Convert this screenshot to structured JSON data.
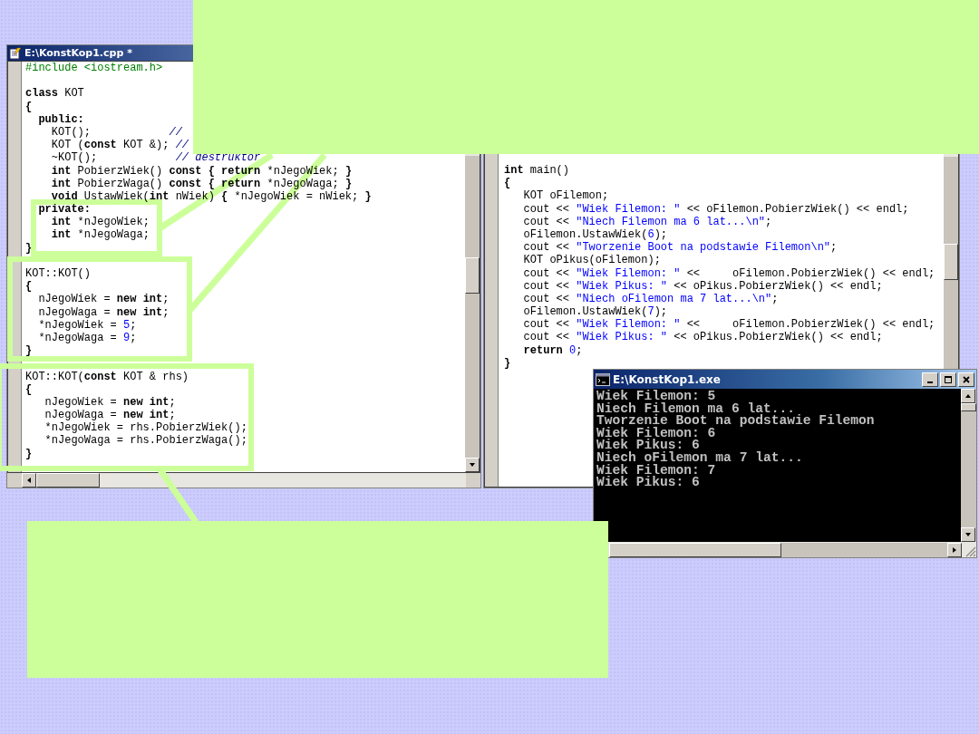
{
  "editor_left": {
    "title": "E:\\KonstKop1.cpp *",
    "lines": [
      {
        "kind": "code",
        "tokens": [
          {
            "kind": "green",
            "text": "#include <iostream.h>"
          }
        ]
      },
      {
        "kind": "blank"
      },
      {
        "kind": "code",
        "tokens": [
          {
            "kind": "bold",
            "text": "class"
          },
          {
            "kind": "plain",
            "text": " KOT"
          }
        ]
      },
      {
        "kind": "code",
        "tokens": [
          {
            "kind": "bold",
            "text": "{"
          }
        ]
      },
      {
        "kind": "code",
        "tokens": [
          {
            "kind": "bold",
            "text": "  public:"
          }
        ]
      },
      {
        "kind": "code",
        "tokens": [
          {
            "kind": "plain",
            "text": "    KOT();            "
          },
          {
            "kind": "comment",
            "text": "//"
          }
        ]
      },
      {
        "kind": "code",
        "tokens": [
          {
            "kind": "plain",
            "text": "    KOT ("
          },
          {
            "kind": "bold",
            "text": "const"
          },
          {
            "kind": "plain",
            "text": " KOT &); "
          },
          {
            "kind": "comment",
            "text": "//"
          }
        ]
      },
      {
        "kind": "code",
        "tokens": [
          {
            "kind": "plain",
            "text": "    ~KOT();            "
          },
          {
            "kind": "comment",
            "text": "// destruktor"
          }
        ]
      },
      {
        "kind": "code",
        "tokens": [
          {
            "kind": "bold",
            "text": "    int"
          },
          {
            "kind": "plain",
            "text": " PobierzWiek() "
          },
          {
            "kind": "bold",
            "text": "const { return"
          },
          {
            "kind": "plain",
            "text": " *nJegoWiek; "
          },
          {
            "kind": "bold",
            "text": "}"
          }
        ]
      },
      {
        "kind": "code",
        "tokens": [
          {
            "kind": "bold",
            "text": "    int"
          },
          {
            "kind": "plain",
            "text": " PobierzWaga() "
          },
          {
            "kind": "bold",
            "text": "const { return"
          },
          {
            "kind": "plain",
            "text": " *nJegoWaga; "
          },
          {
            "kind": "bold",
            "text": "}"
          }
        ]
      },
      {
        "kind": "code",
        "tokens": [
          {
            "kind": "bold",
            "text": "    void"
          },
          {
            "kind": "plain",
            "text": " UstawWiek("
          },
          {
            "kind": "bold",
            "text": "int"
          },
          {
            "kind": "plain",
            "text": " nWiek) "
          },
          {
            "kind": "bold",
            "text": "{"
          },
          {
            "kind": "plain",
            "text": " *nJegoWiek = nWiek; "
          },
          {
            "kind": "bold",
            "text": "}"
          }
        ]
      },
      {
        "kind": "code",
        "tokens": [
          {
            "kind": "bold",
            "text": "  private:"
          }
        ]
      },
      {
        "kind": "code",
        "tokens": [
          {
            "kind": "bold",
            "text": "    int"
          },
          {
            "kind": "plain",
            "text": " *nJegoWiek;"
          }
        ]
      },
      {
        "kind": "code",
        "tokens": [
          {
            "kind": "bold",
            "text": "    int"
          },
          {
            "kind": "plain",
            "text": " *nJegoWaga;"
          }
        ]
      },
      {
        "kind": "code",
        "tokens": [
          {
            "kind": "bold",
            "text": "}"
          }
        ]
      },
      {
        "kind": "blank"
      },
      {
        "kind": "code",
        "tokens": [
          {
            "kind": "plain",
            "text": "KOT::KOT()"
          }
        ]
      },
      {
        "kind": "code",
        "tokens": [
          {
            "kind": "bold",
            "text": "{"
          }
        ]
      },
      {
        "kind": "code",
        "tokens": [
          {
            "kind": "plain",
            "text": "  nJegoWiek = "
          },
          {
            "kind": "bold",
            "text": "new int"
          },
          {
            "kind": "plain",
            "text": ";"
          }
        ]
      },
      {
        "kind": "code",
        "tokens": [
          {
            "kind": "plain",
            "text": "  nJegoWaga = "
          },
          {
            "kind": "bold",
            "text": "new int"
          },
          {
            "kind": "plain",
            "text": ";"
          }
        ]
      },
      {
        "kind": "code",
        "tokens": [
          {
            "kind": "plain",
            "text": "  *nJegoWiek = "
          },
          {
            "kind": "blue",
            "text": "5"
          },
          {
            "kind": "plain",
            "text": ";"
          }
        ]
      },
      {
        "kind": "code",
        "tokens": [
          {
            "kind": "plain",
            "text": "  *nJegoWaga = "
          },
          {
            "kind": "blue",
            "text": "9"
          },
          {
            "kind": "plain",
            "text": ";"
          }
        ]
      },
      {
        "kind": "code",
        "tokens": [
          {
            "kind": "bold",
            "text": "}"
          }
        ]
      },
      {
        "kind": "blank"
      },
      {
        "kind": "code",
        "tokens": [
          {
            "kind": "plain",
            "text": "KOT::KOT("
          },
          {
            "kind": "bold",
            "text": "const"
          },
          {
            "kind": "plain",
            "text": " KOT & rhs)"
          }
        ]
      },
      {
        "kind": "code",
        "tokens": [
          {
            "kind": "bold",
            "text": "{"
          }
        ]
      },
      {
        "kind": "code",
        "tokens": [
          {
            "kind": "plain",
            "text": "   nJegoWiek = "
          },
          {
            "kind": "bold",
            "text": "new int"
          },
          {
            "kind": "plain",
            "text": ";"
          }
        ]
      },
      {
        "kind": "code",
        "tokens": [
          {
            "kind": "plain",
            "text": "   nJegoWaga = "
          },
          {
            "kind": "bold",
            "text": "new int"
          },
          {
            "kind": "plain",
            "text": ";"
          }
        ]
      },
      {
        "kind": "code",
        "tokens": [
          {
            "kind": "plain",
            "text": "   *nJegoWiek = rhs.PobierzWiek();"
          }
        ]
      },
      {
        "kind": "code",
        "tokens": [
          {
            "kind": "plain",
            "text": "   *nJegoWaga = rhs.PobierzWaga();"
          }
        ]
      },
      {
        "kind": "code",
        "tokens": [
          {
            "kind": "bold",
            "text": "}"
          }
        ]
      }
    ]
  },
  "editor_right": {
    "lines": [
      {
        "kind": "code",
        "tokens": [
          {
            "kind": "bold",
            "text": "int"
          },
          {
            "kind": "plain",
            "text": " main()"
          }
        ]
      },
      {
        "kind": "code",
        "tokens": [
          {
            "kind": "bold",
            "text": "{"
          }
        ]
      },
      {
        "kind": "code",
        "tokens": [
          {
            "kind": "plain",
            "text": "   KOT oFilemon;"
          }
        ]
      },
      {
        "kind": "code",
        "tokens": [
          {
            "kind": "plain",
            "text": "   cout << "
          },
          {
            "kind": "blue",
            "text": "\"Wiek Filemon: \""
          },
          {
            "kind": "plain",
            "text": " << oFilemon.PobierzWiek() << endl;"
          }
        ]
      },
      {
        "kind": "code",
        "tokens": [
          {
            "kind": "plain",
            "text": "   cout << "
          },
          {
            "kind": "blue",
            "text": "\"Niech Filemon ma 6 lat...\\n\""
          },
          {
            "kind": "plain",
            "text": ";"
          }
        ]
      },
      {
        "kind": "code",
        "tokens": [
          {
            "kind": "plain",
            "text": "   oFilemon.UstawWiek("
          },
          {
            "kind": "blue",
            "text": "6"
          },
          {
            "kind": "plain",
            "text": ");"
          }
        ]
      },
      {
        "kind": "code",
        "tokens": [
          {
            "kind": "plain",
            "text": "   cout << "
          },
          {
            "kind": "blue",
            "text": "\"Tworzenie Boot na podstawie Filemon\\n\""
          },
          {
            "kind": "plain",
            "text": ";"
          }
        ]
      },
      {
        "kind": "code",
        "tokens": [
          {
            "kind": "plain",
            "text": "   KOT oPikus(oFilemon);"
          }
        ]
      },
      {
        "kind": "code",
        "tokens": [
          {
            "kind": "plain",
            "text": "   cout << "
          },
          {
            "kind": "blue",
            "text": "\"Wiek Filemon: \""
          },
          {
            "kind": "plain",
            "text": " <<     oFilemon.PobierzWiek() << endl;"
          }
        ]
      },
      {
        "kind": "code",
        "tokens": [
          {
            "kind": "plain",
            "text": "   cout << "
          },
          {
            "kind": "blue",
            "text": "\"Wiek Pikus: \""
          },
          {
            "kind": "plain",
            "text": " << oPikus.PobierzWiek() << endl;"
          }
        ]
      },
      {
        "kind": "code",
        "tokens": [
          {
            "kind": "plain",
            "text": "   cout << "
          },
          {
            "kind": "blue",
            "text": "\"Niech oFilemon ma 7 lat...\\n\""
          },
          {
            "kind": "plain",
            "text": ";"
          }
        ]
      },
      {
        "kind": "code",
        "tokens": [
          {
            "kind": "plain",
            "text": "   oFilemon.UstawWiek("
          },
          {
            "kind": "blue",
            "text": "7"
          },
          {
            "kind": "plain",
            "text": ");"
          }
        ]
      },
      {
        "kind": "code",
        "tokens": [
          {
            "kind": "plain",
            "text": "   cout << "
          },
          {
            "kind": "blue",
            "text": "\"Wiek Filemon: \""
          },
          {
            "kind": "plain",
            "text": " <<     oFilemon.PobierzWiek() << endl;"
          }
        ]
      },
      {
        "kind": "code",
        "tokens": [
          {
            "kind": "plain",
            "text": "   cout << "
          },
          {
            "kind": "blue",
            "text": "\"Wiek Pikus: \""
          },
          {
            "kind": "plain",
            "text": " << oPikus.PobierzWiek() << endl;"
          }
        ]
      },
      {
        "kind": "code",
        "tokens": [
          {
            "kind": "bold",
            "text": "   return "
          },
          {
            "kind": "blue",
            "text": "0"
          },
          {
            "kind": "plain",
            "text": ";"
          }
        ]
      },
      {
        "kind": "code",
        "tokens": [
          {
            "kind": "bold",
            "text": "}"
          }
        ]
      }
    ]
  },
  "console": {
    "title": "E:\\KonstKop1.exe",
    "lines": [
      "Wiek Filemon: 5",
      "Niech Filemon ma 6 lat...",
      "Tworzenie Boot na podstawie Filemon",
      "Wiek Filemon: 6",
      "Wiek Pikus: 6",
      "Niech oFilemon ma 7 lat...",
      "Wiek Filemon: 7",
      "Wiek Pikus: 6"
    ]
  }
}
